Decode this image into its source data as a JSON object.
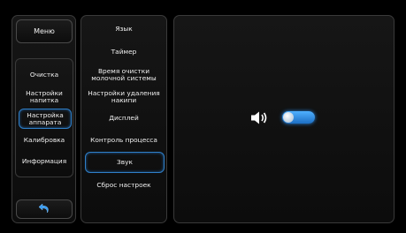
{
  "left_nav": {
    "menu_label": "Меню",
    "items": [
      {
        "label": "Очистка"
      },
      {
        "label": "Настройки\nнапитка"
      },
      {
        "label": "Настройка\nаппарата",
        "selected": true
      },
      {
        "label": "Калибровка"
      },
      {
        "label": "Информация"
      }
    ],
    "back_icon": "back-arrow-icon"
  },
  "settings_list": {
    "items": [
      {
        "label": "Язык"
      },
      {
        "label": "Таймер"
      },
      {
        "label": "Время очистки\nмолочной системы"
      },
      {
        "label": "Настройки удаления\nнакипи"
      },
      {
        "label": "Дисплей"
      },
      {
        "label": "Контроль процесса"
      },
      {
        "label": "Звук",
        "selected": true
      },
      {
        "label": "Сброс настроек"
      }
    ]
  },
  "sound_panel": {
    "icon": "speaker-icon",
    "toggle_on": true,
    "accent": "#3a9cf0"
  }
}
